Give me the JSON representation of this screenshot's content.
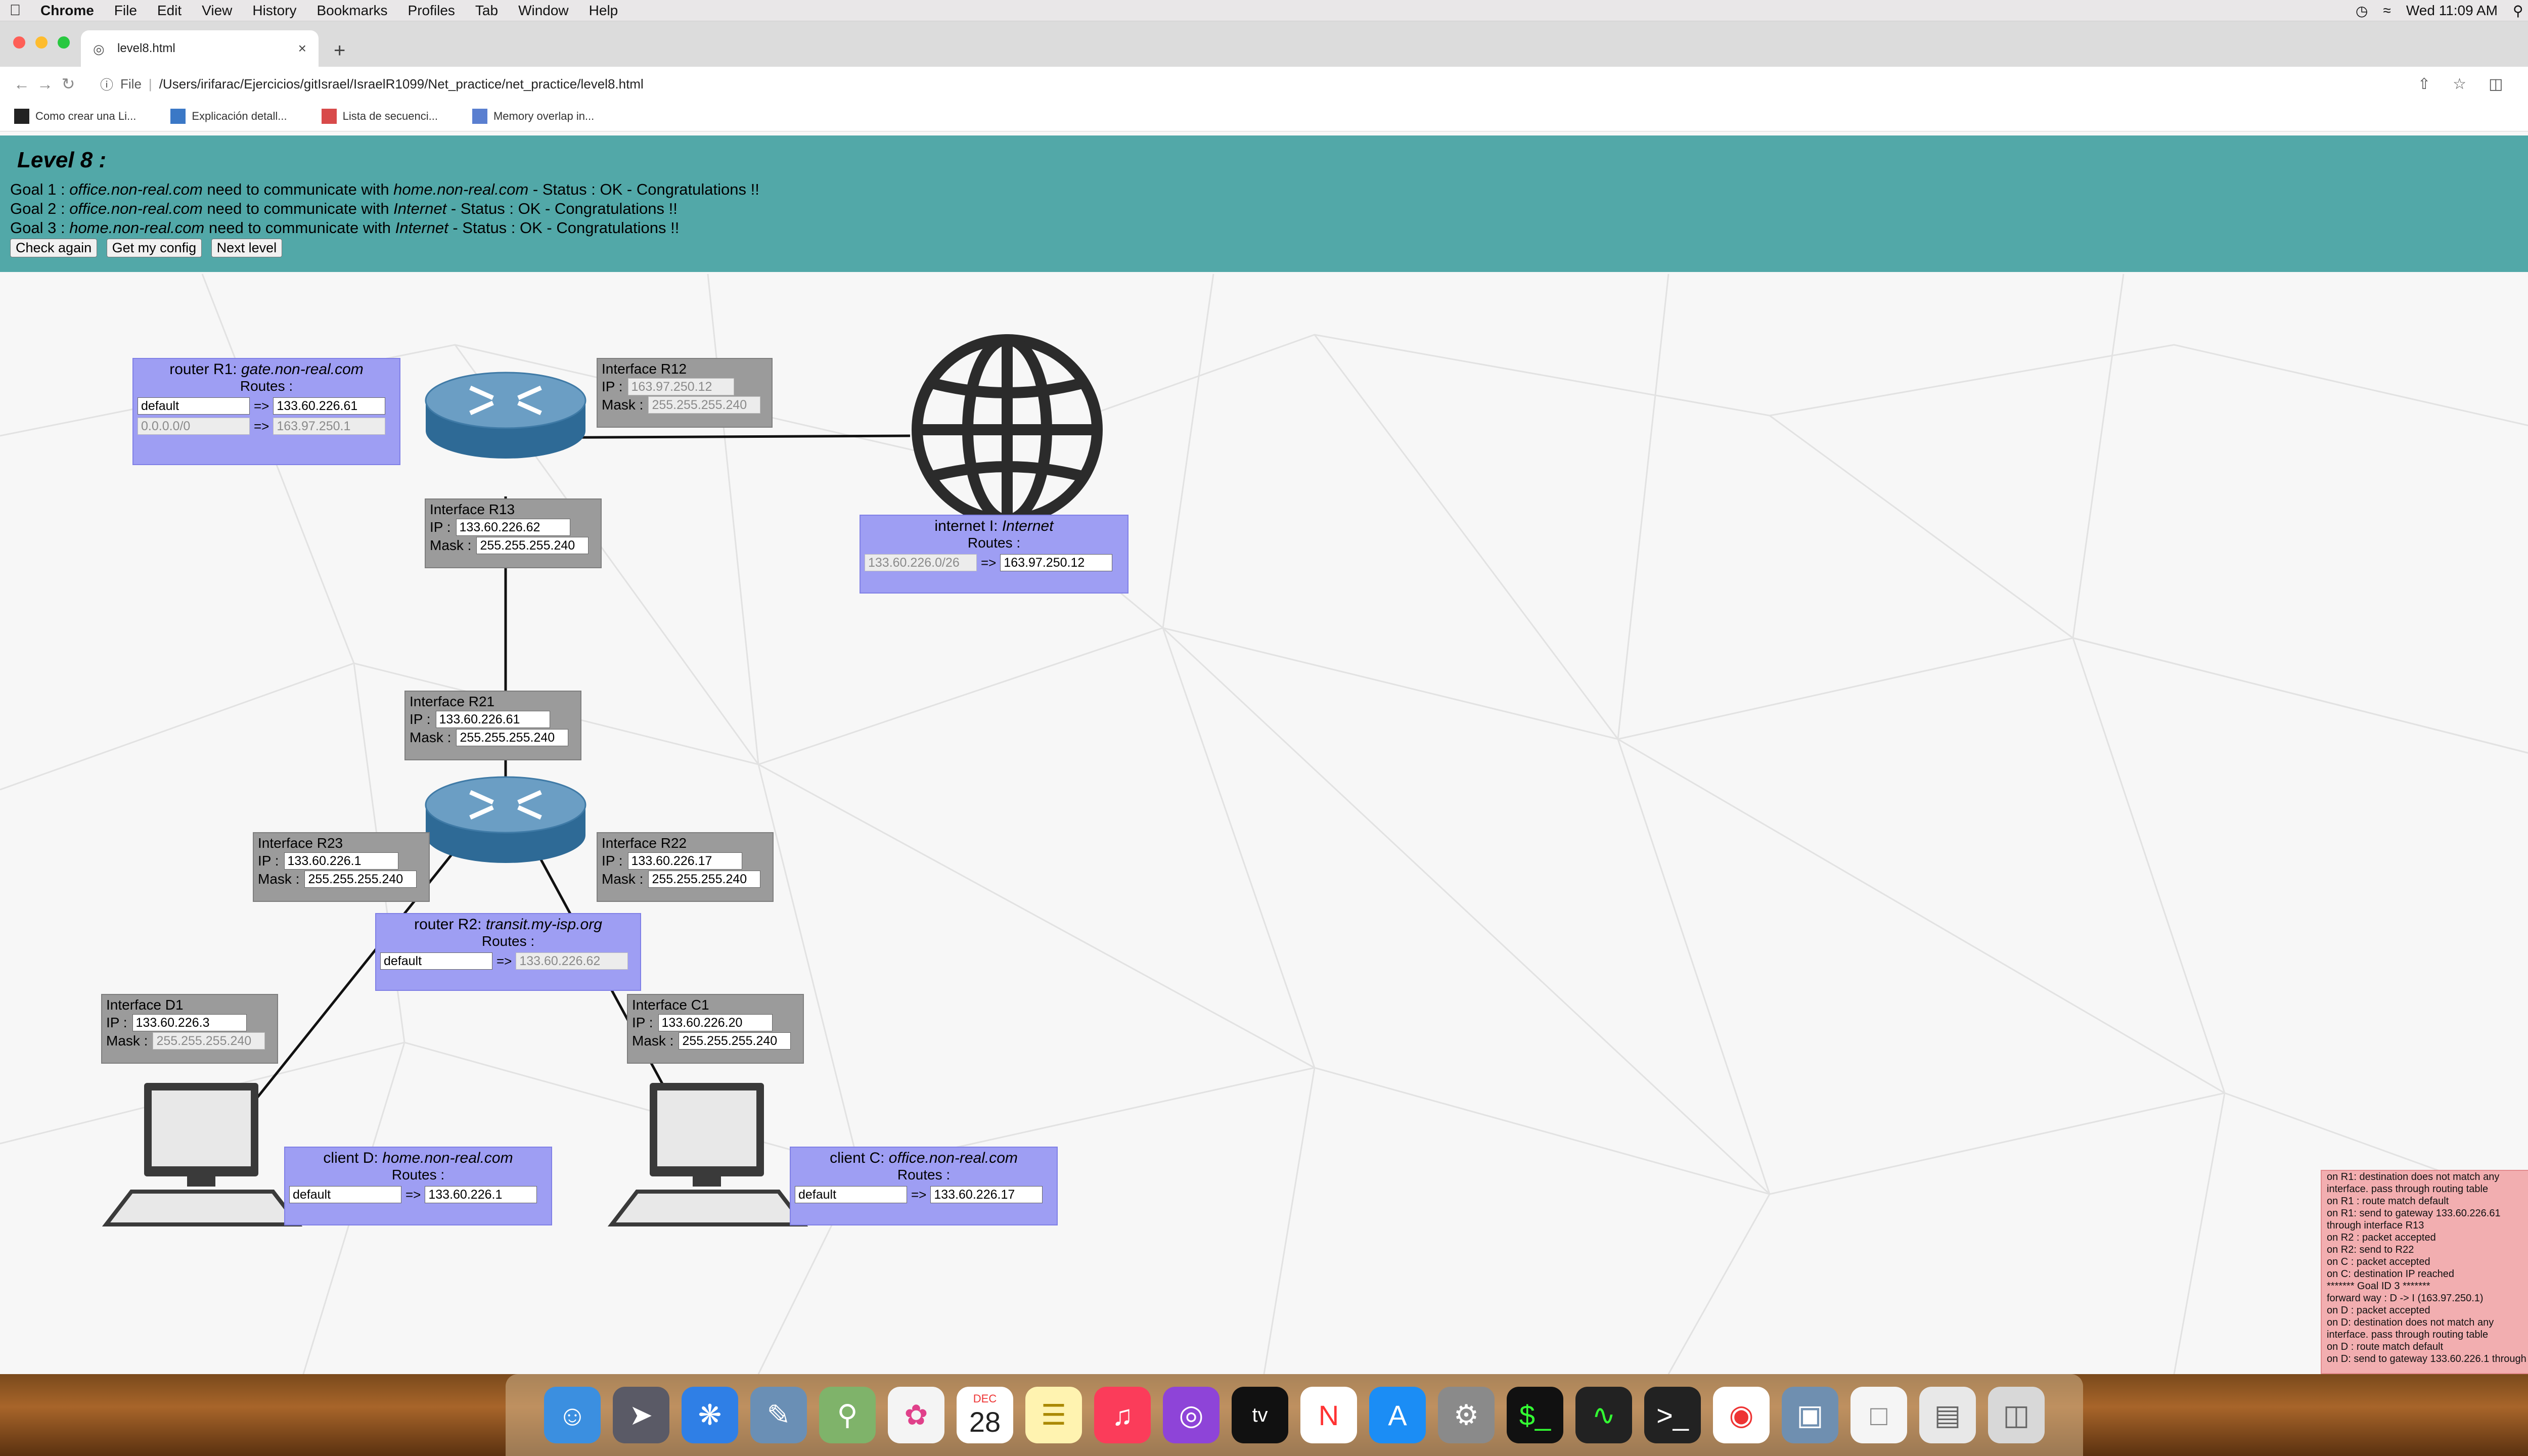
{
  "menubar": {
    "app": "Chrome",
    "items": [
      "File",
      "Edit",
      "View",
      "History",
      "Bookmarks",
      "Profiles",
      "Tab",
      "Window",
      "Help"
    ],
    "clock": "Wed 11:09 AM"
  },
  "tab": {
    "title": "level8.html"
  },
  "address": {
    "scheme": "File",
    "path": "/Users/irifarac/Ejercicios/gitIsrael/IsraelR1099/Net_practice/net_practice/level8.html"
  },
  "bookmarks": [
    {
      "label": "Como crear una Li..."
    },
    {
      "label": "Explicación detall..."
    },
    {
      "label": "Lista de secuenci..."
    },
    {
      "label": "Memory overlap in..."
    }
  ],
  "header": {
    "title": "Level 8 :",
    "goals": [
      {
        "prefix": "Goal 1 : ",
        "a": "office.non-real.com",
        "mid": " need to communicate with ",
        "b": "home.non-real.com",
        "suffix": " - Status : OK - Congratulations !!"
      },
      {
        "prefix": "Goal 2 : ",
        "a": "office.non-real.com",
        "mid": " need to communicate with ",
        "b": "Internet",
        "suffix": " - Status : OK - Congratulations !!"
      },
      {
        "prefix": "Goal 3 : ",
        "a": "home.non-real.com",
        "mid": " need to communicate with ",
        "b": "Internet",
        "suffix": " - Status : OK - Congratulations !!"
      }
    ],
    "buttons": {
      "check": "Check again",
      "config": "Get my config",
      "next": "Next level"
    }
  },
  "labels": {
    "routes": "Routes :",
    "ip": "IP :",
    "mask": "Mask :",
    "arrow": "=>"
  },
  "r1": {
    "prefix": "router R1: ",
    "name": "gate.non-real.com",
    "routes": [
      {
        "dest": "default",
        "gw": "133.60.226.61"
      },
      {
        "dest": "0.0.0.0/0",
        "gw": "163.97.250.1"
      }
    ]
  },
  "r12": {
    "title": "Interface R12",
    "ip": "163.97.250.12",
    "mask": "255.255.255.240"
  },
  "r13": {
    "title": "Interface R13",
    "ip": "133.60.226.62",
    "mask": "255.255.255.240"
  },
  "internet": {
    "prefix": "internet I: ",
    "name": "Internet",
    "route": {
      "dest": "133.60.226.0/26",
      "gw": "163.97.250.12"
    }
  },
  "r21": {
    "title": "Interface R21",
    "ip": "133.60.226.61",
    "mask": "255.255.255.240"
  },
  "r23": {
    "title": "Interface R23",
    "ip": "133.60.226.1",
    "mask": "255.255.255.240"
  },
  "r22": {
    "title": "Interface R22",
    "ip": "133.60.226.17",
    "mask": "255.255.255.240"
  },
  "r2": {
    "prefix": "router R2: ",
    "name": "transit.my-isp.org",
    "route": {
      "dest": "default",
      "gw": "133.60.226.62"
    }
  },
  "d1": {
    "title": "Interface D1",
    "ip": "133.60.226.3",
    "mask": "255.255.255.240"
  },
  "c1": {
    "title": "Interface C1",
    "ip": "133.60.226.20",
    "mask": "255.255.255.240"
  },
  "clientD": {
    "prefix": "client D: ",
    "name": "home.non-real.com",
    "route": {
      "dest": "default",
      "gw": "133.60.226.1"
    }
  },
  "clientC": {
    "prefix": "client C: ",
    "name": "office.non-real.com",
    "route": {
      "dest": "default",
      "gw": "133.60.226.17"
    }
  },
  "log": [
    "on R1: destination does not match any",
    "interface. pass through routing table",
    "on R1 : route match default",
    "on R1: send to gateway 133.60.226.61",
    "through interface R13",
    "on R2 : packet accepted",
    "on R2: send to R22",
    "on C : packet accepted",
    "on C: destination IP reached",
    "******* Goal ID 3 *******",
    "forward way : D -> I (163.97.250.1)",
    "on D : packet accepted",
    "on D: destination does not match any",
    "interface. pass through routing table",
    "on D : route match default",
    "on D: send to gateway 133.60.226.1 through"
  ],
  "dock": {
    "calendar_month": "DEC",
    "calendar_day": "28",
    "tv": "tv"
  },
  "colors": {
    "header": "#52a8a8",
    "router_box": "#9e9ef3",
    "iface_box": "#9b9b9b",
    "log": "#f2aeb0"
  }
}
